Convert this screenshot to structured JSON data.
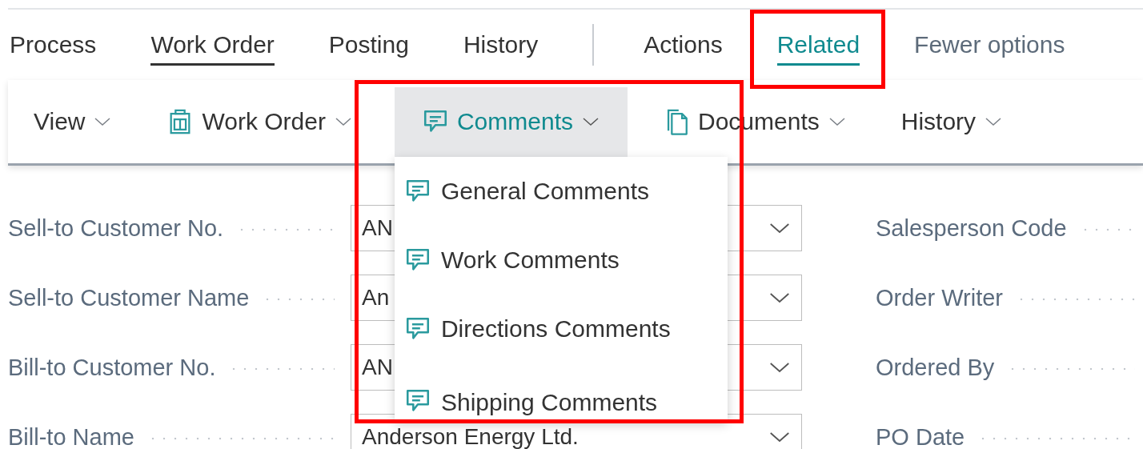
{
  "tabs": [
    {
      "label": "Process",
      "selected": false
    },
    {
      "label": "Work Order",
      "selected": true
    },
    {
      "label": "Posting",
      "selected": false
    },
    {
      "label": "History",
      "selected": false
    }
  ],
  "menus": [
    {
      "label": "Actions",
      "open": false
    },
    {
      "label": "Related",
      "open": true
    }
  ],
  "fewer_options": "Fewer options",
  "toolbar": [
    {
      "label": "View",
      "kind": "plain",
      "open": false
    },
    {
      "label": "Work Order",
      "kind": "form",
      "open": false
    },
    {
      "label": "Comments",
      "kind": "comment",
      "open": true
    },
    {
      "label": "Documents",
      "kind": "pages",
      "open": false
    },
    {
      "label": "History",
      "kind": "plain",
      "open": false
    }
  ],
  "dropdown": [
    {
      "label": "General Comments"
    },
    {
      "label": "Work Comments"
    },
    {
      "label": "Directions Comments"
    },
    {
      "label": "Shipping Comments"
    }
  ],
  "fields": [
    {
      "label": "Sell-to Customer No.",
      "value": "AN"
    },
    {
      "label": "Sell-to Customer Name",
      "value": "An"
    },
    {
      "label": "Bill-to Customer No.",
      "value": "AN"
    },
    {
      "label": "Bill-to Name",
      "value": "Anderson Energy Ltd."
    }
  ],
  "right_fields": [
    {
      "label": "Salesperson Code"
    },
    {
      "label": "Order Writer"
    },
    {
      "label": "Ordered By"
    },
    {
      "label": "PO Date"
    }
  ]
}
